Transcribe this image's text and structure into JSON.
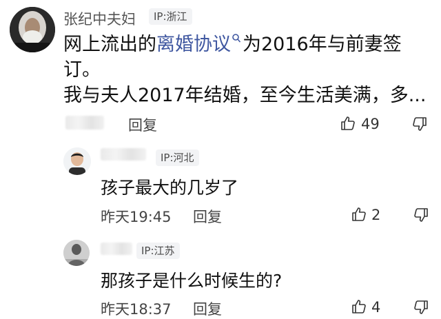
{
  "main_comment": {
    "username": "张纪中夫妇",
    "ip": "IP:浙江",
    "text_before_link": "网上流出的",
    "link_text": "离婚协议",
    "text_after_link": "为2016年与前妻签",
    "line2": "订。",
    "line3": "我与夫人2017年结婚，至今生活美满，多...",
    "reply_label": "回复",
    "like_count": "49"
  },
  "replies": [
    {
      "ip": "IP:河北",
      "text": "孩子最大的几岁了",
      "time": "昨天19:45",
      "reply_label": "回复",
      "like_count": "2"
    },
    {
      "ip": "IP:江苏",
      "text": "那孩子是什么时候生的?",
      "time": "昨天18:37",
      "reply_label": "回复",
      "like_count": "4"
    }
  ],
  "icons": {
    "search_hint": "search-icon",
    "like": "thumbs-up-icon",
    "dislike": "thumbs-down-icon"
  }
}
